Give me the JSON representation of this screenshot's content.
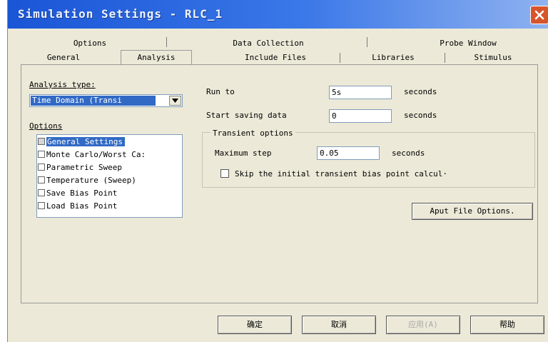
{
  "window": {
    "title": "Simulation Settings - RLC_1"
  },
  "tabs": {
    "row1": [
      "Options",
      "Data Collection",
      "Probe Window"
    ],
    "row2": [
      "General",
      "Analysis",
      "Include Files",
      "Libraries",
      "Stimulus"
    ],
    "active": "Analysis"
  },
  "analysis_type": {
    "label": "Analysis type:",
    "value": "Time Domain (Transi"
  },
  "options": {
    "label": "Options",
    "items": [
      {
        "label": "General Settings",
        "checked": true,
        "selected": true
      },
      {
        "label": "Monte Carlo/Worst Ca:",
        "checked": false,
        "selected": false
      },
      {
        "label": "Parametric Sweep",
        "checked": false,
        "selected": false
      },
      {
        "label": "Temperature (Sweep)",
        "checked": false,
        "selected": false
      },
      {
        "label": "Save Bias Point",
        "checked": false,
        "selected": false
      },
      {
        "label": "Load Bias Point",
        "checked": false,
        "selected": false
      }
    ]
  },
  "run_to": {
    "label": "Run to",
    "value": "5s",
    "unit": "seconds"
  },
  "start_saving": {
    "label": "Start saving data",
    "value": "0",
    "unit": "seconds"
  },
  "transient": {
    "group_label": "Transient options",
    "max_step_label": "Maximum step",
    "max_step_value": "0.05",
    "max_step_unit": "seconds",
    "skip_label": "Skip the initial transient bias point calcul·",
    "skip_checked": false
  },
  "output_file_button": "Aput File Options.",
  "footer": {
    "ok": "确定",
    "cancel": "取消",
    "apply": "应用(A)",
    "help": "帮助"
  }
}
